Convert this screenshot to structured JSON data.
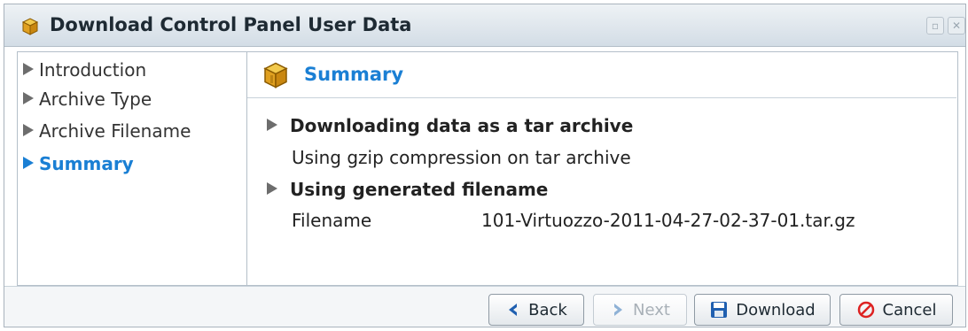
{
  "window": {
    "title": "Download Control Panel User Data"
  },
  "nav": {
    "items": [
      {
        "label": "Introduction"
      },
      {
        "label": "Archive Type"
      },
      {
        "label": "Archive Filename"
      },
      {
        "label": "Summary"
      }
    ],
    "active_index": 3
  },
  "summary": {
    "title": "Summary",
    "archive_heading": "Downloading data as a tar archive",
    "compression_text": "Using gzip compression on tar archive",
    "filename_heading": "Using generated filename",
    "filename_label": "Filename",
    "filename_value": "101-Virtuozzo-2011-04-27-02-37-01.tar.gz"
  },
  "buttons": {
    "back": "Back",
    "next": "Next",
    "download": "Download",
    "cancel": "Cancel"
  },
  "colors": {
    "accent": "#1a7fd4",
    "cancel_red": "#d22",
    "disk_blue": "#1f5fb0"
  }
}
